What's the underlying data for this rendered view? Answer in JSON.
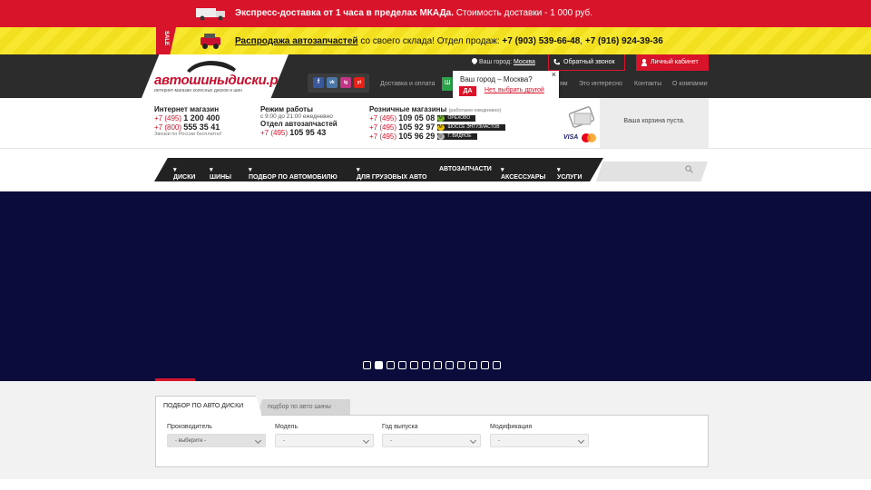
{
  "promo_delivery": {
    "bold": "Экспресс-доставка от 1 часа в пределах МКАДа.",
    "rest": "Стоимость доставки - 1 000 руб."
  },
  "promo_sale": {
    "badge": "SALE",
    "link": "Распродажа автозапчастей",
    "middle": "со своего склада! Отдел продаж:",
    "phone1": "+7 (903) 539-66-48",
    "sep": ",",
    "phone2": "+7 (916) 924-39-36"
  },
  "logo": {
    "name": "автошиныдиски.рф",
    "tagline": "интернет-магазин колесных дисков и шин"
  },
  "social": [
    "f",
    "vk",
    "ig",
    "yt"
  ],
  "header": {
    "city_label": "Ваш город:",
    "city_value": "Москва",
    "callback": "Обратный звонок",
    "cabinet": "Личный кабинет",
    "ship_short": "Ш",
    "menu": [
      "Доставка и оплата",
      "ям",
      "Это интересно",
      "Контакты",
      "О компании"
    ]
  },
  "city_popup": {
    "question": "Ваш город – Москва?",
    "yes": "ДА",
    "no": "Нет, выбрать другой",
    "close": "×"
  },
  "contacts": {
    "online": {
      "title": "Интернет магазин",
      "p1_pre": "+7 (495)",
      "p1_num": "1 200 400",
      "p2_pre": "+7 (800)",
      "p2_num": "555 35 41",
      "note": "Звонки по России бесплатно!"
    },
    "hours": {
      "title": "Режим работы",
      "value": "с 9:00 до 21:00 ежедневно",
      "parts_title": "Отдел автозапчастей",
      "p_pre": "+7 (495)",
      "p_num": "105 95 43"
    },
    "retail": {
      "title": "Розничные магазины",
      "note": "(работаем ежедневно)",
      "stores": [
        {
          "pre": "+7 (495)",
          "num": "109 05 08",
          "badge": "ОРЕХОВО",
          "color": "#7dbb2a"
        },
        {
          "pre": "+7 (495)",
          "num": "105 92 97",
          "badge": "ШОССЕ ЭНТУЗИАСТОВ",
          "color": "#f2c200"
        },
        {
          "pre": "+7 (495)",
          "num": "105 96 29",
          "badge": "Г. ВИДНОЕ",
          "color": "#999999"
        }
      ]
    }
  },
  "cart": {
    "empty": "Ваша корзина пуста.",
    "visa": "VISA"
  },
  "nav": {
    "items": [
      "ДИСКИ",
      "ШИНЫ",
      "ПОДБОР ПО АВТОМОБИЛЮ",
      "ДЛЯ ГРУЗОВЫХ АВТО",
      "АВТОЗАПЧАСТИ",
      "АКСЕССУАРЫ",
      "УСЛУГИ"
    ],
    "search_placeholder": ""
  },
  "slider": {
    "count": 12,
    "active": 1
  },
  "selector": {
    "tab_active": "ПОДБОР ПО АВТО ДИСКИ",
    "tab_inactive": "подбор по авто шины",
    "fields": [
      {
        "label": "Производитель",
        "value": "- выберите -"
      },
      {
        "label": "Модель",
        "value": "-"
      },
      {
        "label": "Год выпуска",
        "value": "-"
      },
      {
        "label": "Модификация",
        "value": "-"
      }
    ]
  },
  "colors": {
    "brand_red": "#d8142a",
    "dark": "#2c2c2c",
    "hero": "#0b0c3b",
    "yellow": "#f7e72f"
  }
}
